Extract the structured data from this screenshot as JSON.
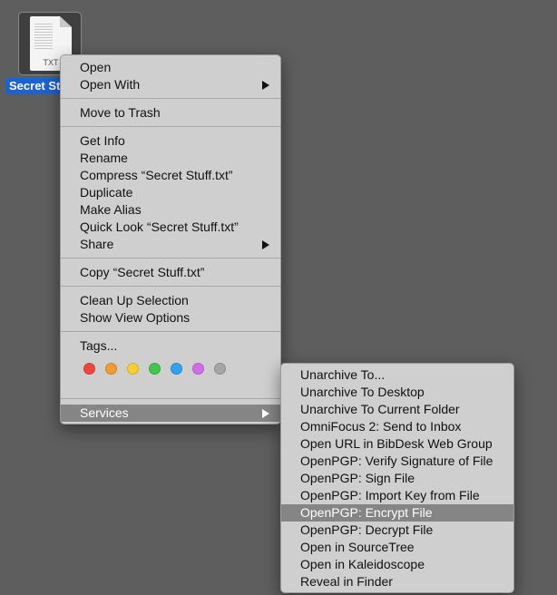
{
  "file": {
    "label": "Secret Stu",
    "ext": "TXT"
  },
  "context_menu": {
    "open": "Open",
    "open_with": "Open With",
    "move_to_trash": "Move to Trash",
    "get_info": "Get Info",
    "rename": "Rename",
    "compress": "Compress “Secret Stuff.txt”",
    "duplicate": "Duplicate",
    "make_alias": "Make Alias",
    "quick_look": "Quick Look “Secret Stuff.txt”",
    "share": "Share",
    "copy": "Copy “Secret Stuff.txt”",
    "clean_up": "Clean Up Selection",
    "show_view_options": "Show View Options",
    "tags": "Tags...",
    "services": "Services"
  },
  "tag_colors": {
    "red": "#f0453f",
    "orange": "#f59a2e",
    "yellow": "#f5cf32",
    "green": "#3fc84a",
    "blue": "#2fa2ef",
    "purple": "#d36ce6",
    "gray": "#a5a5a5"
  },
  "services_menu": {
    "items": [
      "Unarchive To...",
      "Unarchive To Desktop",
      "Unarchive To Current Folder",
      "OmniFocus 2: Send to Inbox",
      "Open URL in BibDesk Web Group",
      "OpenPGP: Verify Signature of File",
      "OpenPGP: Sign File",
      "OpenPGP: Import Key from File",
      "OpenPGP: Encrypt File",
      "OpenPGP: Decrypt File",
      "Open in SourceTree",
      "Open in Kaleidoscope",
      "Reveal in Finder"
    ],
    "highlighted_index": 8
  }
}
